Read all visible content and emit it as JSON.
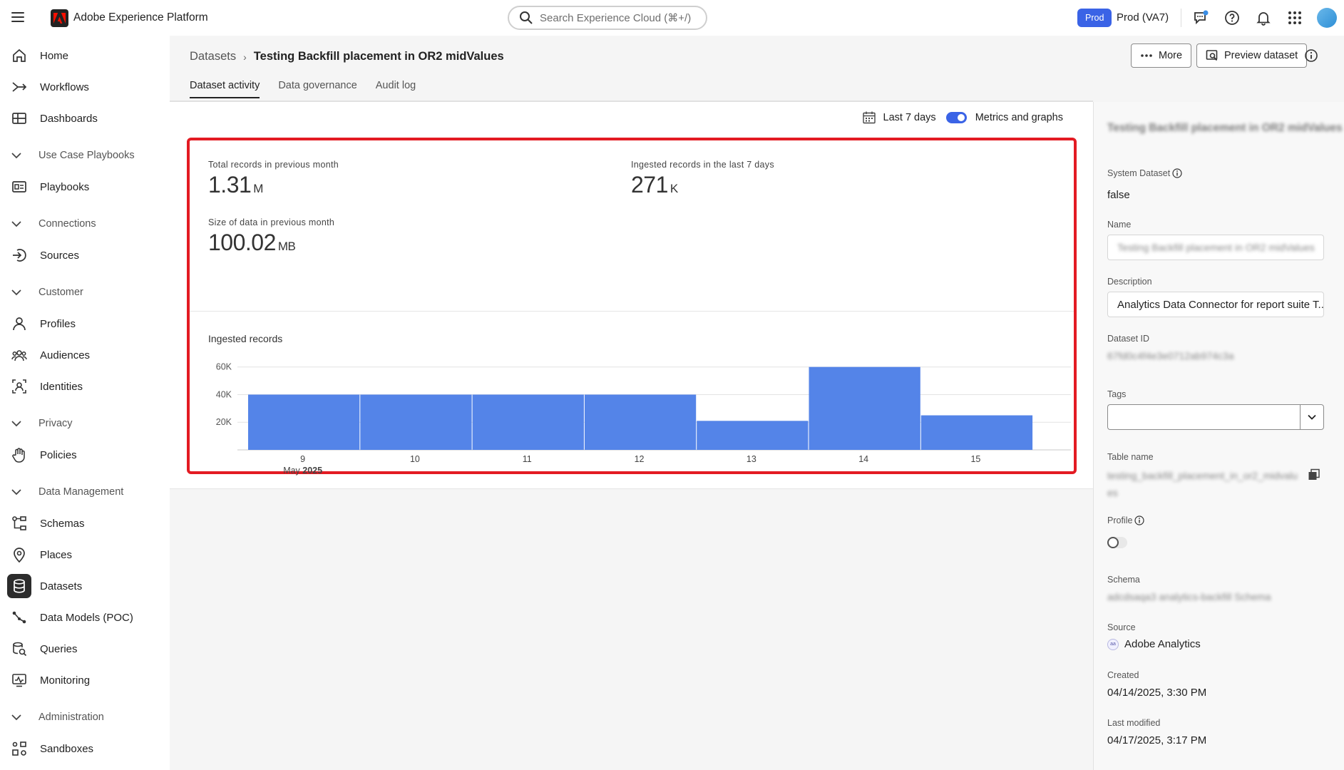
{
  "app": {
    "title": "Adobe Experience Platform"
  },
  "topbar": {
    "search_placeholder": "Search Experience Cloud (⌘+/)",
    "env_badge": "Prod",
    "env_label": "Prod (VA7)"
  },
  "sidebar": {
    "items": [
      {
        "label": "Home",
        "icon": "home-icon"
      },
      {
        "label": "Workflows",
        "icon": "workflows-icon"
      },
      {
        "label": "Dashboards",
        "icon": "dashboards-icon"
      },
      {
        "label": "Playbooks",
        "icon": "playbooks-icon"
      },
      {
        "label": "Sources",
        "icon": "sources-icon"
      },
      {
        "label": "Profiles",
        "icon": "profiles-icon"
      },
      {
        "label": "Audiences",
        "icon": "audiences-icon"
      },
      {
        "label": "Identities",
        "icon": "identities-icon"
      },
      {
        "label": "Policies",
        "icon": "policies-icon"
      },
      {
        "label": "Schemas",
        "icon": "schemas-icon"
      },
      {
        "label": "Places",
        "icon": "places-icon"
      },
      {
        "label": "Datasets",
        "icon": "datasets-icon"
      },
      {
        "label": "Data Models (POC)",
        "icon": "data-models-icon"
      },
      {
        "label": "Queries",
        "icon": "queries-icon"
      },
      {
        "label": "Monitoring",
        "icon": "monitoring-icon"
      },
      {
        "label": "Sandboxes",
        "icon": "sandboxes-icon"
      }
    ],
    "sections": [
      {
        "label": "Use Case Playbooks"
      },
      {
        "label": "Connections"
      },
      {
        "label": "Customer"
      },
      {
        "label": "Privacy"
      },
      {
        "label": "Data Management"
      },
      {
        "label": "Administration"
      }
    ],
    "active": "Datasets"
  },
  "header": {
    "breadcrumb_parent": "Datasets",
    "breadcrumb_current": "Testing Backfill placement in OR2 midValues",
    "more_label": "More",
    "preview_label": "Preview dataset",
    "tabs": [
      {
        "label": "Dataset activity",
        "active": true
      },
      {
        "label": "Data governance",
        "active": false
      },
      {
        "label": "Audit log",
        "active": false
      }
    ]
  },
  "activity": {
    "range_label": "Last 7 days",
    "toggle_label": "Metrics and graphs",
    "toggle_on": true,
    "metrics": [
      {
        "label": "Total records in previous month",
        "value": "1.31",
        "unit": "M"
      },
      {
        "label": "Ingested records in the last 7 days",
        "value": "271",
        "unit": "K"
      },
      {
        "label": "Size of data in previous month",
        "value": "100.02",
        "unit": "MB"
      }
    ],
    "chart_title": "Ingested records",
    "month_label": "May",
    "year_label": "2025"
  },
  "chart_data": {
    "type": "bar",
    "title": "Ingested records",
    "categories": [
      "9",
      "10",
      "11",
      "12",
      "13",
      "14",
      "15"
    ],
    "values": [
      40000,
      40000,
      40000,
      40000,
      21000,
      60000,
      25000
    ],
    "y_ticks": [
      "20K",
      "40K",
      "60K"
    ],
    "ylim": [
      0,
      65000
    ],
    "grid": true,
    "color": "#5484e8",
    "x_caption": "May 2025"
  },
  "panel": {
    "title": "Testing Backfill placement in OR2 midValues",
    "system_dataset_label": "System Dataset",
    "system_dataset_value": "false",
    "name_label": "Name",
    "name_value": "Testing Backfill placement in OR2 midValues",
    "description_label": "Description",
    "description_value": "Analytics Data Connector for report suite T...",
    "dataset_id_label": "Dataset ID",
    "dataset_id_value": "67fd0c4f4e3e0712ab974c3a",
    "tags_label": "Tags",
    "table_name_label": "Table name",
    "table_name_value": "testing_backfill_placement_in_or2_midvalues",
    "profile_label": "Profile",
    "profile_on": false,
    "schema_label": "Schema",
    "schema_value": "adcdsaqa3 analytics-backfill Schema",
    "source_label": "Source",
    "source_value": "Adobe Analytics",
    "created_label": "Created",
    "created_value": "04/14/2025, 3:30 PM",
    "modified_label": "Last modified",
    "modified_value": "04/17/2025, 3:17 PM"
  }
}
